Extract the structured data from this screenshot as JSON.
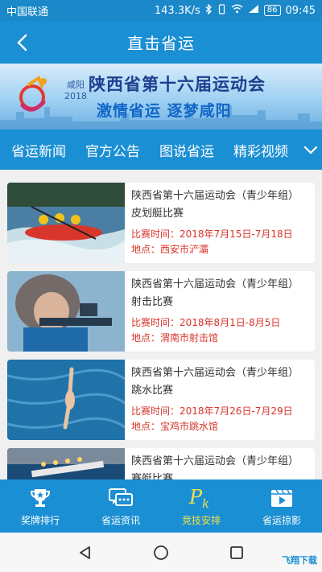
{
  "status_bar": {
    "carrier": "中国联通",
    "speed": "143.3K/s",
    "battery": "86",
    "time": "09:45"
  },
  "header": {
    "title": "直击省运"
  },
  "banner": {
    "city": "咸阳",
    "year": "2018",
    "title": "陕西省第十六届运动会",
    "slogan": "激情省运  逐梦咸阳"
  },
  "tabs": [
    {
      "label": "省运新闻"
    },
    {
      "label": "官方公告"
    },
    {
      "label": "图说省运"
    },
    {
      "label": "精彩视频"
    }
  ],
  "events": [
    {
      "title": "陕西省第十六届运动会（青少年组）皮划艇比赛",
      "time": "比赛时间：2018年7月15日-7月18日",
      "place": "地点：西安市浐灞",
      "thumb": "kayak"
    },
    {
      "title": "陕西省第十六届运动会（青少年组）射击比赛",
      "time": "比赛时间：2018年8月1日-8月5日",
      "place": "地点：渭南市射击馆",
      "thumb": "shooting"
    },
    {
      "title": "陕西省第十六届运动会（青少年组）跳水比赛",
      "time": "比赛时间：2018年7月26日-7月29日",
      "place": "地点：宝鸡市跳水馆",
      "thumb": "diving"
    },
    {
      "title": "陕西省第十六届运动会（青少年组）赛艇比赛",
      "time": "",
      "place": "",
      "thumb": "rowing"
    }
  ],
  "bottom_nav": [
    {
      "label": "奖牌排行",
      "icon": "trophy-icon"
    },
    {
      "label": "省运资讯",
      "icon": "chat-icon"
    },
    {
      "label": "竞技安排",
      "icon": "pk-icon",
      "active": true
    },
    {
      "label": "省运掠影",
      "icon": "video-icon"
    }
  ],
  "watermark": "飞翔下载",
  "colors": {
    "primary": "#1b8fd3",
    "accent_red": "#d9342b",
    "active_tab": "#f3e04a"
  }
}
